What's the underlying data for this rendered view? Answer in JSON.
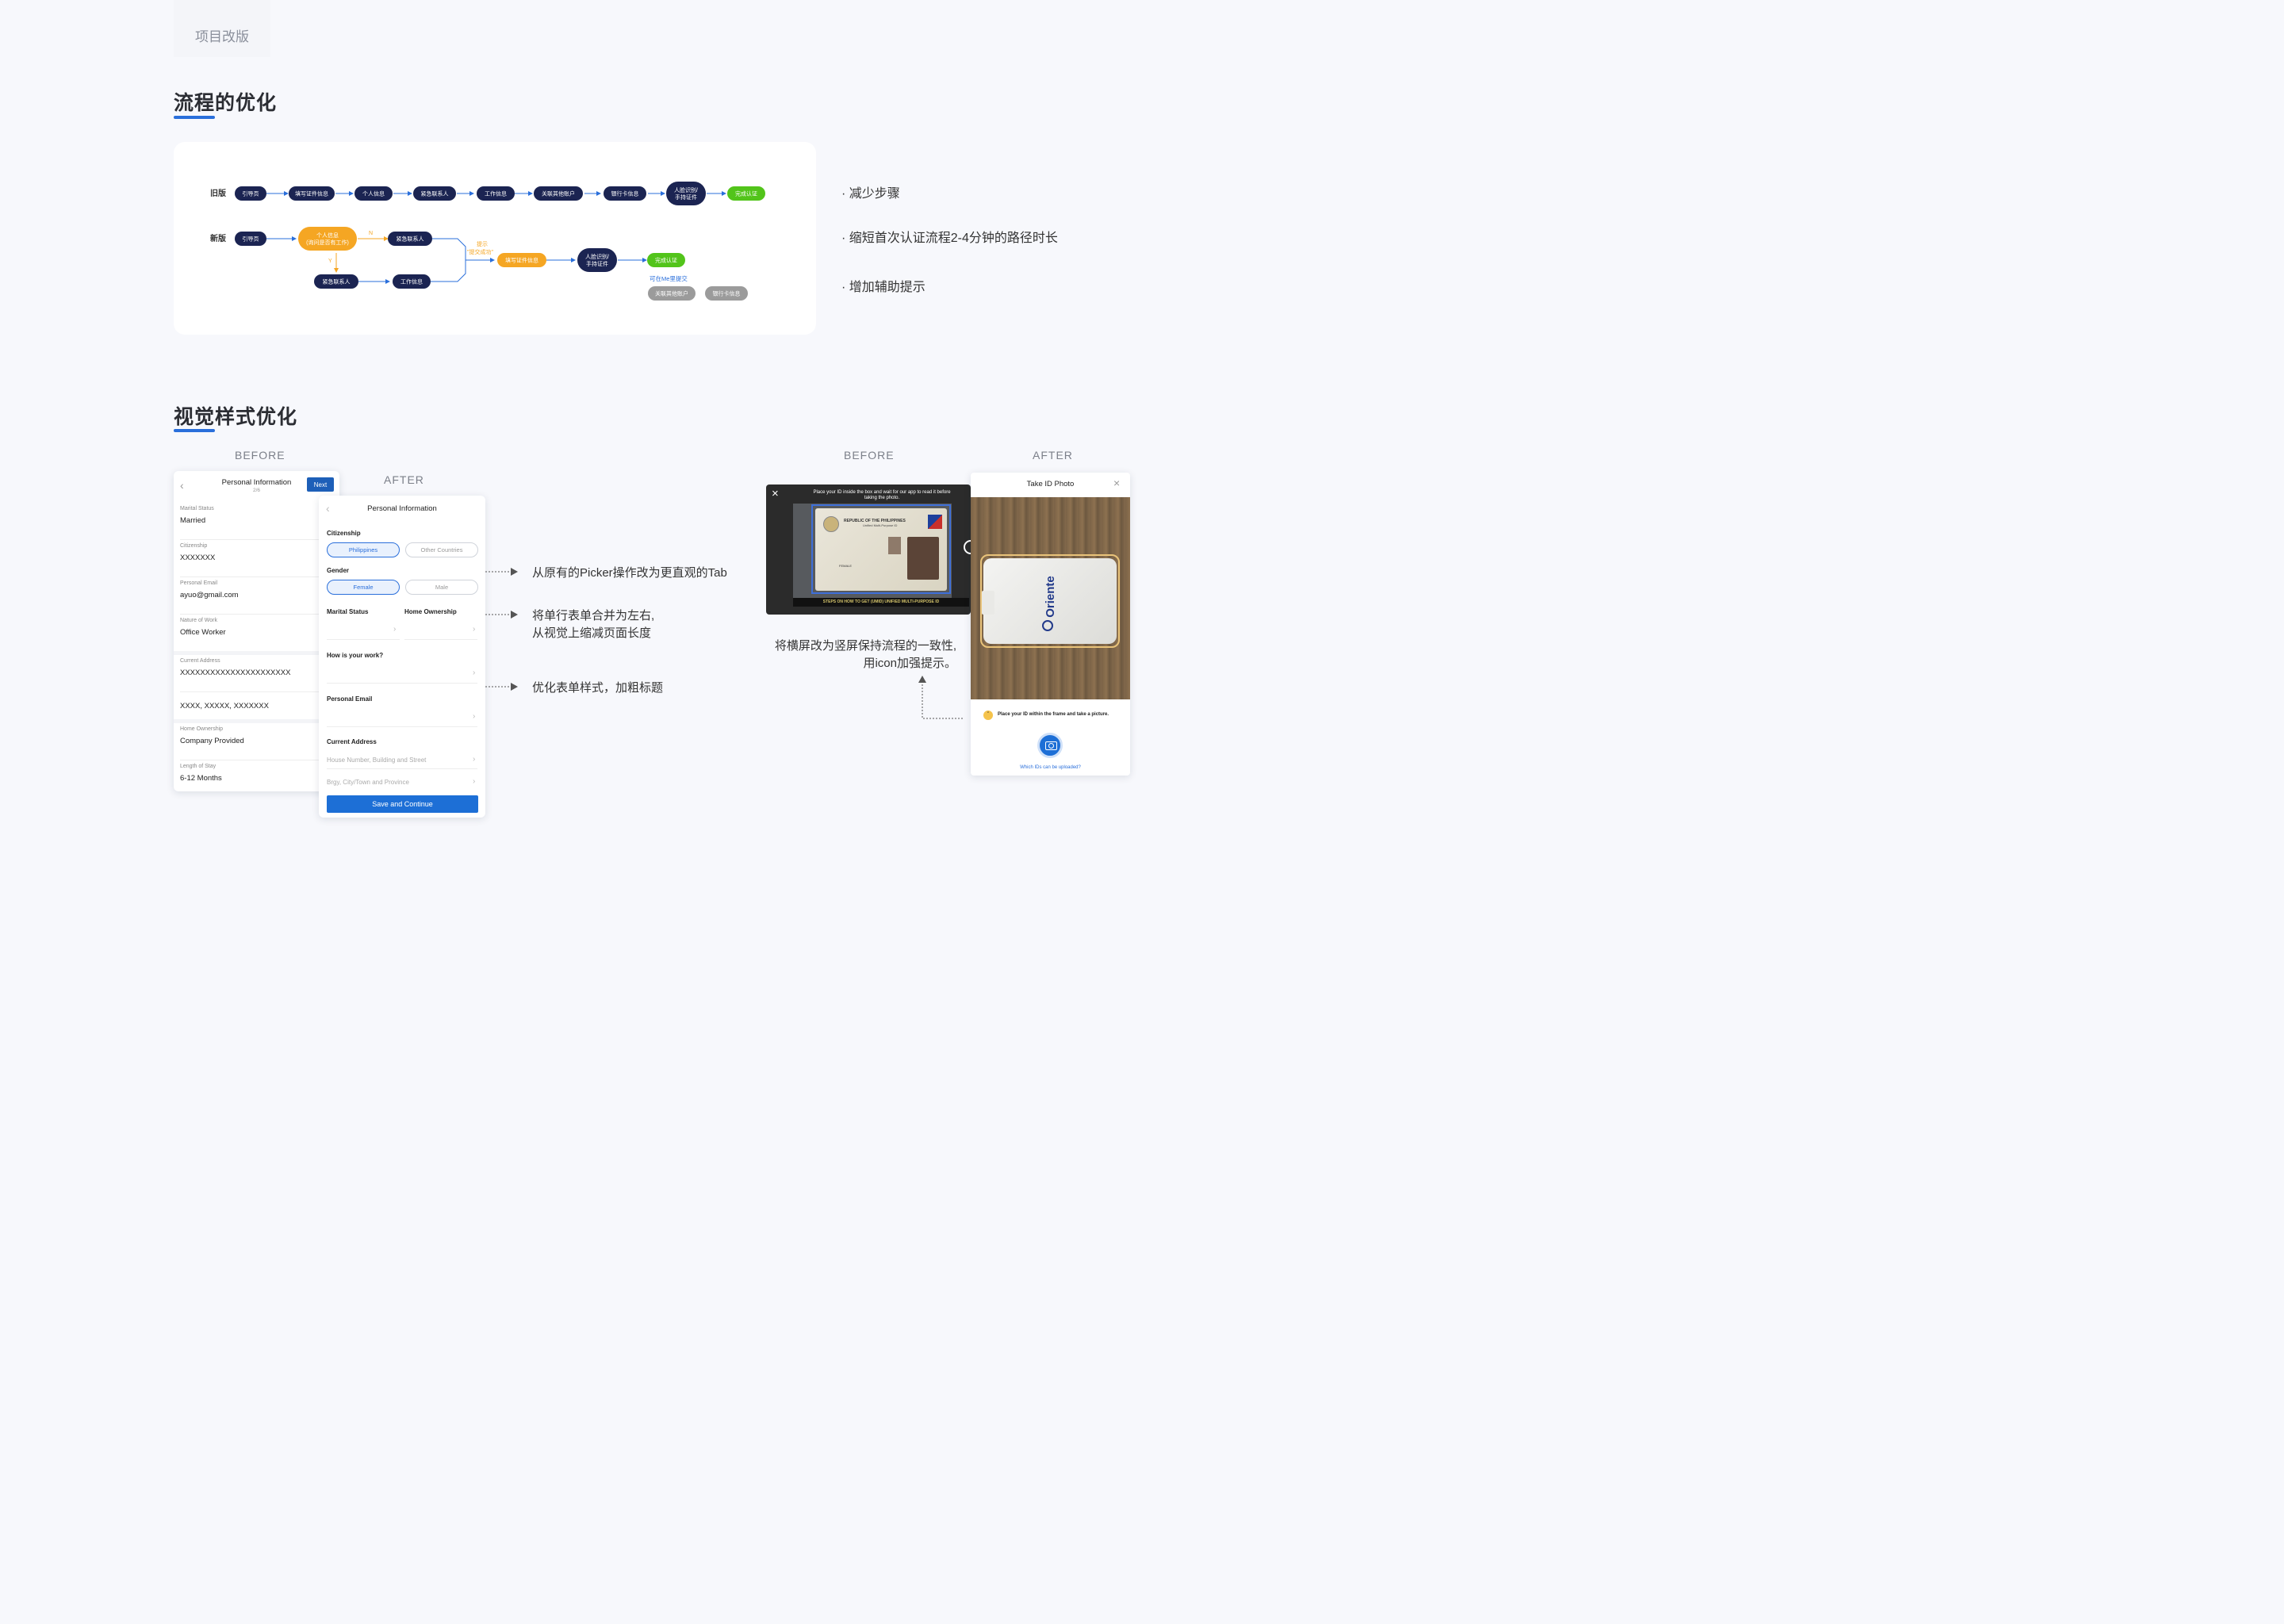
{
  "tag": "项目改版",
  "section1": {
    "title": "流程的优化",
    "old_label": "旧版",
    "new_label": "新版",
    "old_flow": [
      "引导页",
      "填写证件信息",
      "个人信息",
      "紧急联系人",
      "工作信息",
      "关联其他账户",
      "银行卡信息",
      "人脸识别/手持证件",
      "完成认证"
    ],
    "new_flow": {
      "start": "引导页",
      "personal": "个人信息\n(询问是否有工作)",
      "n": "N",
      "y": "Y",
      "emergency_top": "紧急联系人",
      "emergency_bottom": "紧急联系人",
      "work": "工作信息",
      "hint": "提示\n\"提交成功\"",
      "id_info": "填写证件信息",
      "face": "人脸识别/手持证件",
      "done": "完成认证",
      "optional_note": "可在Me里提交",
      "link_accounts": "关联其他账户",
      "bank": "银行卡信息"
    },
    "bullets": [
      "· 减少步骤",
      "· 缩短首次认证流程2-4分钟的路径时长",
      "· 增加辅助提示"
    ]
  },
  "section2": {
    "title": "视觉样式优化",
    "before_label": "BEFORE",
    "after_label": "AFTER",
    "before_label_2": "BEFORE",
    "after_label_2": "AFTER",
    "before_form": {
      "title": "Personal Information",
      "step": "2/6",
      "next": "Next",
      "fields": [
        {
          "label": "Marital Status",
          "value": "Married"
        },
        {
          "label": "Citizenship",
          "value": "XXXXXXX"
        },
        {
          "label": "Personal Email",
          "value": "ayuo@gmail.com"
        },
        {
          "label": "Nature of Work",
          "value": "Office Worker"
        },
        {
          "label": "Current Address",
          "value": "XXXXXXXXXXXXXXXXXXXXXX"
        },
        {
          "label": "",
          "value": "XXXX, XXXXX, XXXXXXX"
        },
        {
          "label": "Home Ownership",
          "value": "Company Provided"
        },
        {
          "label": "Length of Stay",
          "value": "6-12 Months"
        }
      ]
    },
    "after_form": {
      "title": "Personal Information",
      "citizenship": "Citizenship",
      "cit_options": [
        "Philippines",
        "Other Countries"
      ],
      "gender": "Gender",
      "gender_options": [
        "Female",
        "Male"
      ],
      "marital": "Marital Status",
      "home": "Home Ownership",
      "work": "How is your work?",
      "email": "Personal Email",
      "address": "Current Address",
      "addr_ph1": "House Number, Building and Street",
      "addr_ph2": "Brgy, City/Town and Province",
      "save": "Save and Continue"
    },
    "notes": {
      "n1": "从原有的Picker操作改为更直观的Tab",
      "n2": "将单行表单合并为左右,\n从视觉上缩减页面长度",
      "n3": "优化表单样式，加粗标题",
      "n4": "将横屏改为竖屏保持流程的一致性,\n用icon加强提示。"
    },
    "before_photo": {
      "instruction": "Place your ID inside the box and wait for our app to read it before taking the photo.",
      "card_title": "REPUBLIC OF THE PHILIPPINES",
      "card_sub": "Unified Multi-Purpose ID",
      "card_text": "FEMALE",
      "banner": "STEPS ON HOW TO GET (UMID) UNIFIED MULTI-PURPOSE ID"
    },
    "after_photo": {
      "title": "Take ID Photo",
      "brand": "Oriente",
      "hint": "Place your ID within the frame and take a picture.",
      "link": "Which IDs can be uploaded?"
    }
  },
  "colors": {
    "accent": "#2a6fdb",
    "navy": "#1b2452",
    "orange": "#f5a623",
    "green": "#52c41a",
    "gray": "#9b9b9b"
  }
}
